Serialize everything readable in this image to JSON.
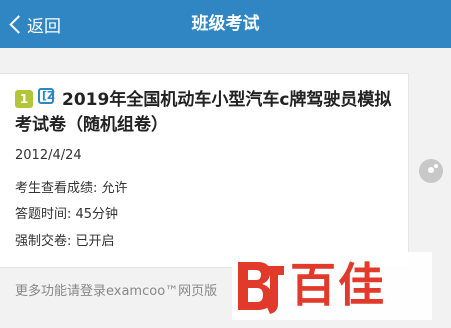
{
  "header": {
    "back_label": "返回",
    "title": "班级考试"
  },
  "exam": {
    "number": "1",
    "type_glyph": "[Z",
    "title": "2019年全国机动车小型汽车c牌驾驶员模拟考试卷（随机组卷）",
    "date": "2012/4/24",
    "view_results": "考生查看成绩: 允许",
    "duration": "答题时间: 45分钟",
    "force_submit": "强制交卷: 已开启"
  },
  "footer": {
    "text": "更多功能请登录examcoo™网页版"
  },
  "watermark": {
    "brand": "百佳",
    "color": "#e13a2b"
  },
  "colors": {
    "header_bg": "#2f86c3",
    "badge_bg": "#b3c63a",
    "page_bg": "#f2f2f2"
  }
}
